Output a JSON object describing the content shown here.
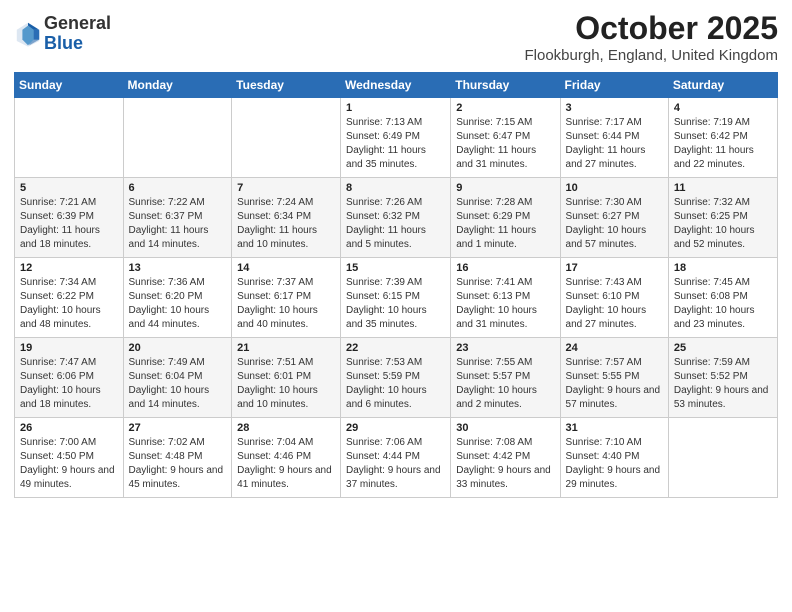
{
  "logo": {
    "general": "General",
    "blue": "Blue"
  },
  "header": {
    "month": "October 2025",
    "location": "Flookburgh, England, United Kingdom"
  },
  "days_of_week": [
    "Sunday",
    "Monday",
    "Tuesday",
    "Wednesday",
    "Thursday",
    "Friday",
    "Saturday"
  ],
  "weeks": [
    [
      {
        "day": "",
        "info": ""
      },
      {
        "day": "",
        "info": ""
      },
      {
        "day": "",
        "info": ""
      },
      {
        "day": "1",
        "info": "Sunrise: 7:13 AM\nSunset: 6:49 PM\nDaylight: 11 hours and 35 minutes."
      },
      {
        "day": "2",
        "info": "Sunrise: 7:15 AM\nSunset: 6:47 PM\nDaylight: 11 hours and 31 minutes."
      },
      {
        "day": "3",
        "info": "Sunrise: 7:17 AM\nSunset: 6:44 PM\nDaylight: 11 hours and 27 minutes."
      },
      {
        "day": "4",
        "info": "Sunrise: 7:19 AM\nSunset: 6:42 PM\nDaylight: 11 hours and 22 minutes."
      }
    ],
    [
      {
        "day": "5",
        "info": "Sunrise: 7:21 AM\nSunset: 6:39 PM\nDaylight: 11 hours and 18 minutes."
      },
      {
        "day": "6",
        "info": "Sunrise: 7:22 AM\nSunset: 6:37 PM\nDaylight: 11 hours and 14 minutes."
      },
      {
        "day": "7",
        "info": "Sunrise: 7:24 AM\nSunset: 6:34 PM\nDaylight: 11 hours and 10 minutes."
      },
      {
        "day": "8",
        "info": "Sunrise: 7:26 AM\nSunset: 6:32 PM\nDaylight: 11 hours and 5 minutes."
      },
      {
        "day": "9",
        "info": "Sunrise: 7:28 AM\nSunset: 6:29 PM\nDaylight: 11 hours and 1 minute."
      },
      {
        "day": "10",
        "info": "Sunrise: 7:30 AM\nSunset: 6:27 PM\nDaylight: 10 hours and 57 minutes."
      },
      {
        "day": "11",
        "info": "Sunrise: 7:32 AM\nSunset: 6:25 PM\nDaylight: 10 hours and 52 minutes."
      }
    ],
    [
      {
        "day": "12",
        "info": "Sunrise: 7:34 AM\nSunset: 6:22 PM\nDaylight: 10 hours and 48 minutes."
      },
      {
        "day": "13",
        "info": "Sunrise: 7:36 AM\nSunset: 6:20 PM\nDaylight: 10 hours and 44 minutes."
      },
      {
        "day": "14",
        "info": "Sunrise: 7:37 AM\nSunset: 6:17 PM\nDaylight: 10 hours and 40 minutes."
      },
      {
        "day": "15",
        "info": "Sunrise: 7:39 AM\nSunset: 6:15 PM\nDaylight: 10 hours and 35 minutes."
      },
      {
        "day": "16",
        "info": "Sunrise: 7:41 AM\nSunset: 6:13 PM\nDaylight: 10 hours and 31 minutes."
      },
      {
        "day": "17",
        "info": "Sunrise: 7:43 AM\nSunset: 6:10 PM\nDaylight: 10 hours and 27 minutes."
      },
      {
        "day": "18",
        "info": "Sunrise: 7:45 AM\nSunset: 6:08 PM\nDaylight: 10 hours and 23 minutes."
      }
    ],
    [
      {
        "day": "19",
        "info": "Sunrise: 7:47 AM\nSunset: 6:06 PM\nDaylight: 10 hours and 18 minutes."
      },
      {
        "day": "20",
        "info": "Sunrise: 7:49 AM\nSunset: 6:04 PM\nDaylight: 10 hours and 14 minutes."
      },
      {
        "day": "21",
        "info": "Sunrise: 7:51 AM\nSunset: 6:01 PM\nDaylight: 10 hours and 10 minutes."
      },
      {
        "day": "22",
        "info": "Sunrise: 7:53 AM\nSunset: 5:59 PM\nDaylight: 10 hours and 6 minutes."
      },
      {
        "day": "23",
        "info": "Sunrise: 7:55 AM\nSunset: 5:57 PM\nDaylight: 10 hours and 2 minutes."
      },
      {
        "day": "24",
        "info": "Sunrise: 7:57 AM\nSunset: 5:55 PM\nDaylight: 9 hours and 57 minutes."
      },
      {
        "day": "25",
        "info": "Sunrise: 7:59 AM\nSunset: 5:52 PM\nDaylight: 9 hours and 53 minutes."
      }
    ],
    [
      {
        "day": "26",
        "info": "Sunrise: 7:00 AM\nSunset: 4:50 PM\nDaylight: 9 hours and 49 minutes."
      },
      {
        "day": "27",
        "info": "Sunrise: 7:02 AM\nSunset: 4:48 PM\nDaylight: 9 hours and 45 minutes."
      },
      {
        "day": "28",
        "info": "Sunrise: 7:04 AM\nSunset: 4:46 PM\nDaylight: 9 hours and 41 minutes."
      },
      {
        "day": "29",
        "info": "Sunrise: 7:06 AM\nSunset: 4:44 PM\nDaylight: 9 hours and 37 minutes."
      },
      {
        "day": "30",
        "info": "Sunrise: 7:08 AM\nSunset: 4:42 PM\nDaylight: 9 hours and 33 minutes."
      },
      {
        "day": "31",
        "info": "Sunrise: 7:10 AM\nSunset: 4:40 PM\nDaylight: 9 hours and 29 minutes."
      },
      {
        "day": "",
        "info": ""
      }
    ]
  ]
}
